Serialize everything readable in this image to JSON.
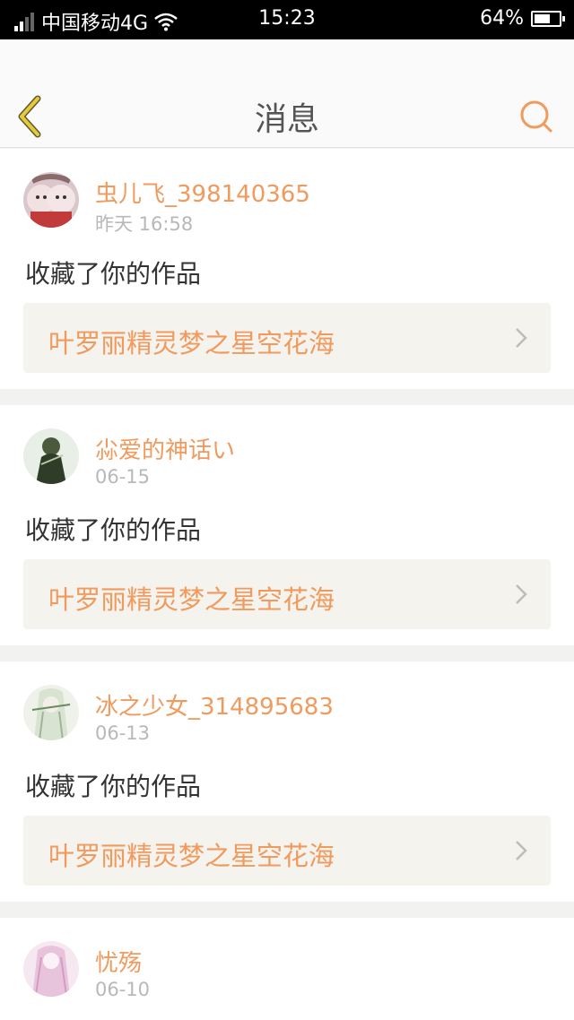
{
  "status_bar": {
    "carrier": "中国移动4G",
    "time": "15:23",
    "battery_percent": "64%",
    "battery_level": 0.64,
    "signal_bars": 2
  },
  "header": {
    "title": "消息",
    "back_icon": "chevron-left-icon",
    "search_icon": "search-icon"
  },
  "colors": {
    "accent": "#f09a5e",
    "back_icon": "#e8c93a",
    "card_bg": "#ffffff",
    "link_bg": "#f4f3ee"
  },
  "notifications": [
    {
      "user": "虫儿飞_398140365",
      "time": "昨天 16:58",
      "action": "收藏了你的作品",
      "work": "叶罗丽精灵梦之星空花海"
    },
    {
      "user": "尛爱的神话い",
      "time": "06-15",
      "action": "收藏了你的作品",
      "work": "叶罗丽精灵梦之星空花海"
    },
    {
      "user": "冰之少女_314895683",
      "time": "06-13",
      "action": "收藏了你的作品",
      "work": "叶罗丽精灵梦之星空花海"
    },
    {
      "user": "忧殇",
      "time": "06-10"
    }
  ]
}
